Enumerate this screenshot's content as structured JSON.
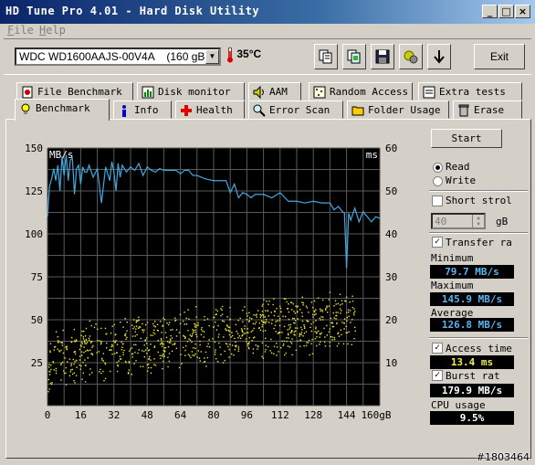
{
  "window": {
    "title": "HD Tune Pro 4.01 - Hard Disk Utility",
    "buttons": [
      "_",
      "□",
      "×"
    ]
  },
  "menu": [
    "File",
    "Help"
  ],
  "toolbar": {
    "drive": "WDC WD1600AAJS-00V4A    (160 gB)",
    "temperature": "35°C",
    "tools": [
      "copy-text-icon",
      "copy-screenshot-icon",
      "save-icon",
      "options-icon",
      "download-icon"
    ],
    "exit_label": "Exit"
  },
  "tabs_row1": [
    {
      "label": "File Benchmark",
      "icon": "file-benchmark-icon"
    },
    {
      "label": "Disk monitor",
      "icon": "disk-monitor-icon"
    },
    {
      "label": "AAM",
      "icon": "speaker-icon"
    },
    {
      "label": "Random Access",
      "icon": "random-access-icon"
    },
    {
      "label": "Extra tests",
      "icon": "extra-tests-icon"
    }
  ],
  "tabs_row2": [
    {
      "label": "Benchmark",
      "icon": "bulb-icon",
      "active": true
    },
    {
      "label": "Info",
      "icon": "info-icon"
    },
    {
      "label": "Health",
      "icon": "health-cross-icon"
    },
    {
      "label": "Error Scan",
      "icon": "magnifier-icon"
    },
    {
      "label": "Folder Usage",
      "icon": "folder-icon"
    },
    {
      "label": "Erase",
      "icon": "trash-icon"
    }
  ],
  "controls": {
    "start_label": "Start",
    "read_label": "Read",
    "write_label": "Write",
    "mode_selected": "Read",
    "short_stroke_label": "Short strol",
    "short_stroke_checked": false,
    "short_stroke_value": "40",
    "short_stroke_unit": "gB",
    "transfer_rate_label": "Transfer ra",
    "transfer_rate_checked": true,
    "access_time_label": "Access time",
    "access_time_checked": true,
    "burst_rate_label": "Burst rat",
    "burst_rate_checked": true
  },
  "stats": {
    "minimum_label": "Minimum",
    "minimum": "79.7 MB/s",
    "maximum_label": "Maximum",
    "maximum": "145.9 MB/s",
    "average_label": "Average",
    "average": "126.8 MB/s",
    "access_time": "13.4 ms",
    "burst_rate": "179.9 MB/s",
    "cpu_label": "CPU usage",
    "cpu_usage": "9.5%"
  },
  "colors": {
    "transfer_line": "#3fa9e0",
    "access_points": "#e8e830",
    "value_blue": "#5ab4f0",
    "value_yellow": "#f0f050",
    "value_white": "#ffffff"
  },
  "chart_data": {
    "type": "line",
    "xlabel": "gB",
    "ylabel_left": "MB/s",
    "ylabel_right": "ms",
    "xlim": [
      0,
      160
    ],
    "ylim_left": [
      0,
      150
    ],
    "ylim_right": [
      0,
      60
    ],
    "x_ticks": [
      "0",
      "16",
      "32",
      "48",
      "64",
      "80",
      "96",
      "112",
      "128",
      "144",
      "160gB"
    ],
    "y_ticks_left": [
      "150",
      "125",
      "100",
      "75",
      "50",
      "25"
    ],
    "y_ticks_right": [
      "60",
      "50",
      "40",
      "30",
      "20",
      "10"
    ],
    "grid": true,
    "series": [
      {
        "name": "Transfer rate",
        "axis": "left",
        "x": [
          0,
          1,
          2,
          3,
          4,
          5,
          6,
          7,
          8,
          9,
          10,
          11,
          12,
          13,
          14,
          15,
          16,
          17,
          18,
          19,
          20,
          22,
          24,
          26,
          28,
          30,
          31,
          32,
          33,
          34,
          35,
          36,
          38,
          40,
          42,
          44,
          46,
          48,
          50,
          52,
          54,
          56,
          58,
          60,
          62,
          64,
          66,
          68,
          70,
          72,
          76,
          80,
          84,
          86,
          88,
          90,
          92,
          94,
          96,
          98,
          100,
          104,
          108,
          112,
          116,
          120,
          124,
          128,
          132,
          136,
          138,
          140,
          142,
          143,
          144,
          145,
          146,
          148,
          150,
          152,
          154,
          156,
          158,
          160
        ],
        "values": [
          110,
          128,
          132,
          138,
          131,
          140,
          125,
          145,
          134,
          146,
          131,
          143,
          144,
          123,
          138,
          140,
          129,
          139,
          136,
          136,
          140,
          133,
          138,
          118,
          139,
          131,
          142,
          136,
          125,
          141,
          133,
          140,
          136,
          139,
          137,
          141,
          134,
          139,
          137,
          136,
          138,
          137,
          137,
          137,
          137,
          135,
          137,
          137,
          134,
          134,
          132,
          131,
          131,
          131,
          124,
          129,
          121,
          124,
          123,
          121,
          123,
          123,
          121,
          124,
          119,
          119,
          118,
          119,
          118,
          118,
          114,
          116,
          113,
          112,
          80,
          112,
          108,
          115,
          107,
          113,
          110,
          107,
          110,
          109
        ]
      },
      {
        "name": "Access time",
        "axis": "right",
        "type": "scatter",
        "trend_ms": [
          [
            0,
            10.5
          ],
          [
            16,
            12.5
          ],
          [
            32,
            13.5
          ],
          [
            48,
            14.5
          ],
          [
            64,
            15.5
          ],
          [
            80,
            16.5
          ],
          [
            96,
            17.5
          ],
          [
            112,
            18.5
          ],
          [
            128,
            19.2
          ],
          [
            144,
            20
          ]
        ]
      }
    ]
  },
  "watermark": "#1803464"
}
